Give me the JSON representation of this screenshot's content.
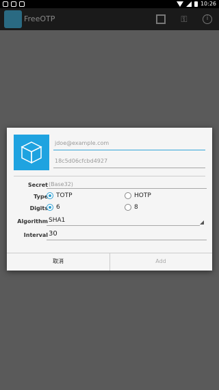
{
  "status_bar": {
    "time": "10:26"
  },
  "app_bar": {
    "title": "FreeOTP"
  },
  "dialog": {
    "issuer_placeholder": "jdoe@example.com",
    "id_placeholder": "18c5d06cfcbd4927",
    "secret_label": "Secret",
    "secret_placeholder": "(Base32)",
    "type_label": "Type",
    "type_options": [
      "TOTP",
      "HOTP"
    ],
    "type_selected": "TOTP",
    "digits_label": "Digits",
    "digits_options": [
      "6",
      "8"
    ],
    "digits_selected": "6",
    "algorithm_label": "Algorithm",
    "algorithm_value": "SHA1",
    "interval_label": "Interval",
    "interval_value": "30",
    "cancel_label": "取消",
    "add_label": "Add"
  },
  "colors": {
    "accent": "#2f9fd2",
    "token_image_bg": "#1fa3e0",
    "scrim": "#5a5a5a"
  },
  "icons": [
    "qr-code-icon",
    "add-key-icon",
    "info-icon",
    "cube-icon"
  ]
}
